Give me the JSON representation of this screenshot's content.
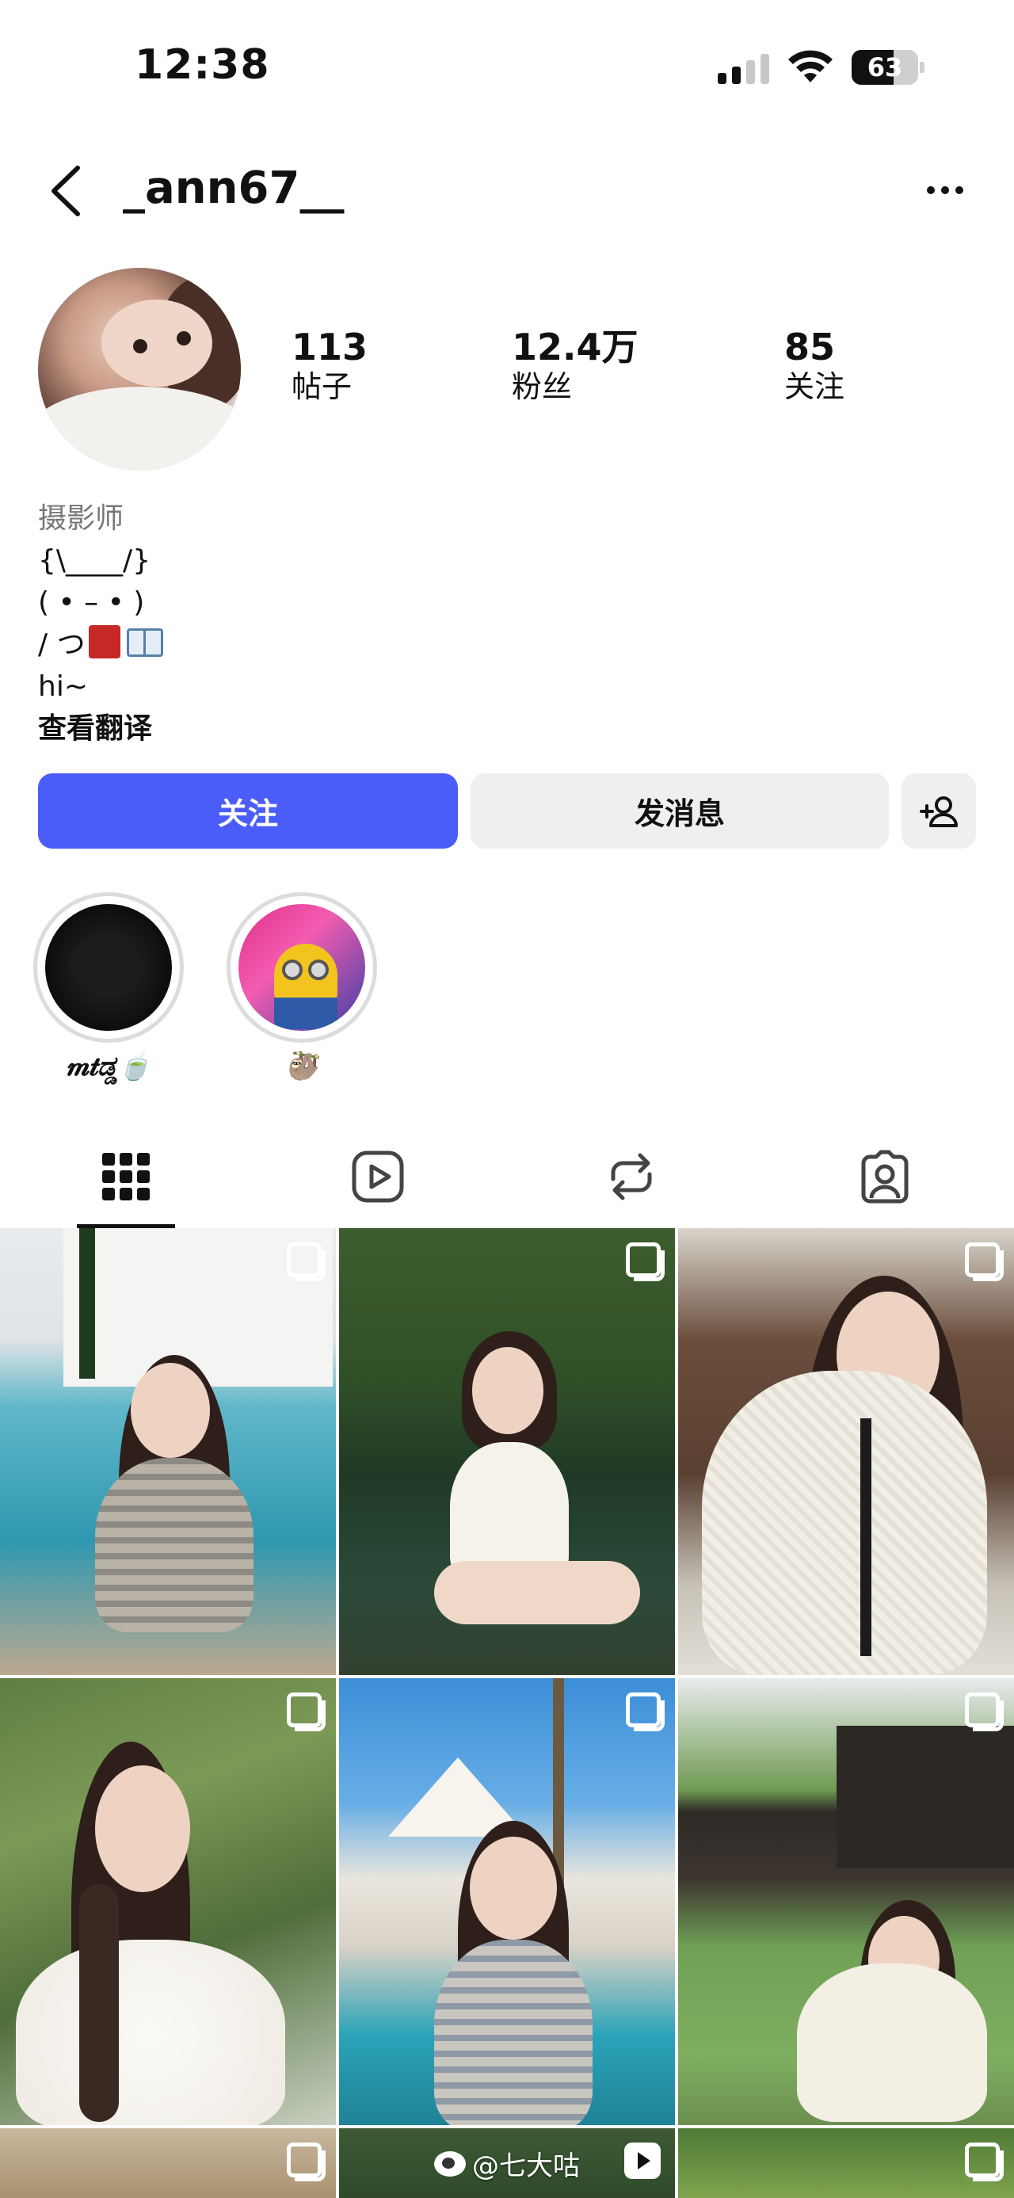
{
  "status_bar": {
    "time": "12:38",
    "battery": "63",
    "battery_level": 0.63
  },
  "header": {
    "username": "_ann67__"
  },
  "profile": {
    "stats": [
      {
        "value": "113",
        "label": "帖子"
      },
      {
        "value": "12.4万",
        "label": "粉丝"
      },
      {
        "value": "85",
        "label": "关注"
      }
    ],
    "bio": {
      "category": "摄影师",
      "line1": "{\\____/}",
      "line2": "( • – • )",
      "line3": "/ つ",
      "line4": "hi~",
      "translate": "查看翻译"
    }
  },
  "actions": {
    "follow": "关注",
    "message": "发消息"
  },
  "highlights": [
    {
      "label": "𝒎𝒕ಡ್ಡ🍵"
    },
    {
      "label": "🦥"
    }
  ],
  "tabs": [
    "posts-grid",
    "reels",
    "reposts",
    "tagged"
  ],
  "watermark": "@七大咕",
  "colors": {
    "follow": "#4a5df9",
    "secondary_button": "#efefef"
  }
}
